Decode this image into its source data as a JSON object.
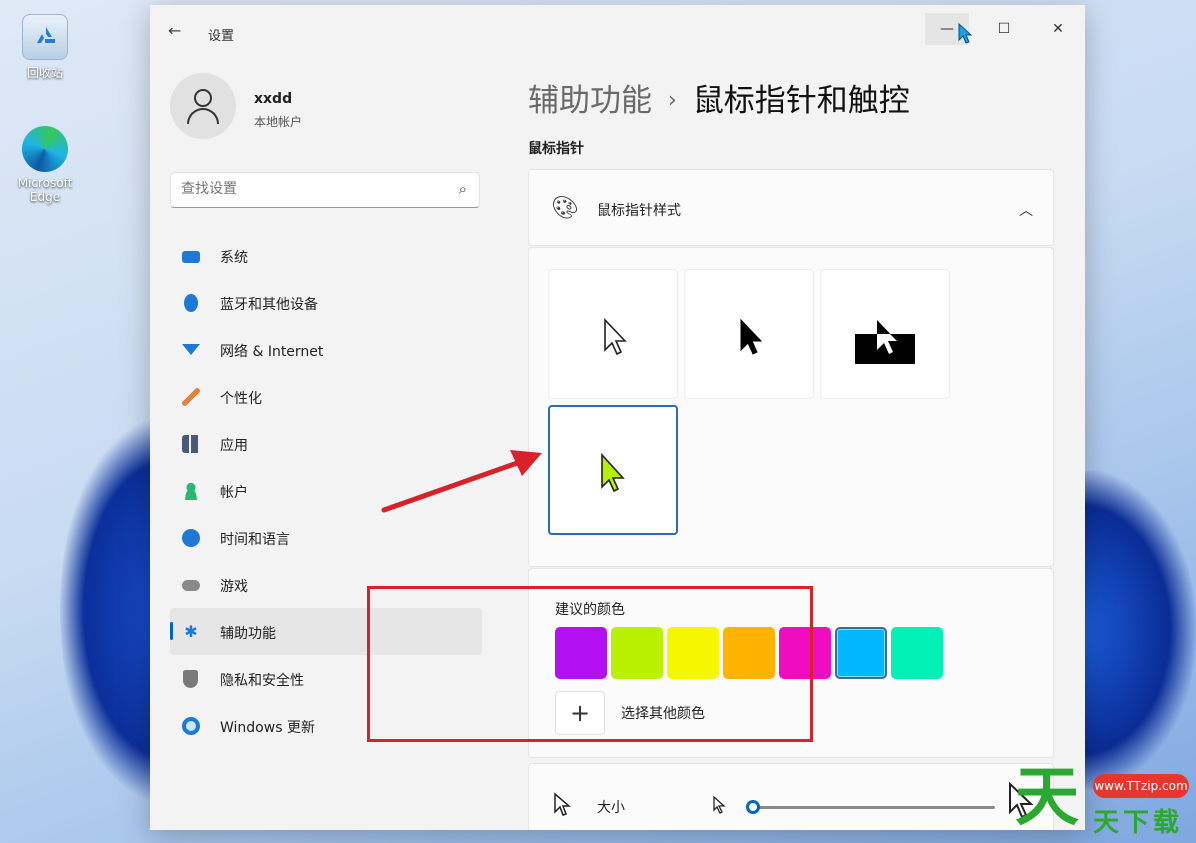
{
  "desktop": {
    "icons": [
      {
        "label": "回收站",
        "icon": "recycle-bin-icon"
      },
      {
        "label": "Microsoft Edge",
        "icon": "edge-icon"
      }
    ]
  },
  "window": {
    "app_title": "设置",
    "back_icon": "back-arrow-icon",
    "controls": {
      "minimize": "—",
      "maximize": "☐",
      "close": "✕"
    }
  },
  "profile": {
    "name": "xxdd",
    "account_type": "本地帐户"
  },
  "search": {
    "placeholder": "查找设置",
    "value": "查找设置"
  },
  "nav": {
    "items": [
      {
        "label": "系统",
        "icon": "system-icon",
        "color": "#1e78d6"
      },
      {
        "label": "蓝牙和其他设备",
        "icon": "bluetooth-icon",
        "color": "#1e78d6"
      },
      {
        "label": "网络 & Internet",
        "icon": "wifi-icon",
        "color": "#1e78d6"
      },
      {
        "label": "个性化",
        "icon": "brush-icon",
        "color": "#e0843a"
      },
      {
        "label": "应用",
        "icon": "apps-icon",
        "color": "#4a5a72"
      },
      {
        "label": "帐户",
        "icon": "account-icon",
        "color": "#2bb673"
      },
      {
        "label": "时间和语言",
        "icon": "globe-clock-icon",
        "color": "#1e78d6"
      },
      {
        "label": "游戏",
        "icon": "gamepad-icon",
        "color": "#7a7a7a"
      },
      {
        "label": "辅助功能",
        "icon": "accessibility-icon",
        "color": "#1e78d6"
      },
      {
        "label": "隐私和安全性",
        "icon": "shield-icon",
        "color": "#6b6b6b"
      },
      {
        "label": "Windows 更新",
        "icon": "update-icon",
        "color": "#1e78d6"
      }
    ],
    "active_index": 8
  },
  "breadcrumb": {
    "parent": "辅助功能",
    "separator": "›",
    "current": "鼠标指针和触控"
  },
  "section": {
    "title": "鼠标指针"
  },
  "pointer_style": {
    "label": "鼠标指针样式",
    "icon": "palette-icon",
    "expand_icon": "chevron-up-icon",
    "options": [
      {
        "name": "white",
        "icon": "cursor-white-icon"
      },
      {
        "name": "black",
        "icon": "cursor-black-icon"
      },
      {
        "name": "inverted",
        "icon": "cursor-inverted-icon"
      },
      {
        "name": "custom",
        "icon": "cursor-custom-icon",
        "color": "#b4f000",
        "selected": true
      }
    ]
  },
  "colors": {
    "label": "建议的颜色",
    "swatches": [
      "#b30ff0",
      "#b8f000",
      "#f6f600",
      "#ffb300",
      "#f00cc0",
      "#00b8ff",
      "#00f0b8"
    ],
    "selected_index": 5,
    "more_button": "+",
    "more_label": "选择其他颜色"
  },
  "size": {
    "label": "大小",
    "value": 0.02
  },
  "watermark": {
    "url": "www.TTzip.com",
    "big": "天",
    "text": "天下载"
  },
  "annotation": {
    "arrow_color": "#d8222a"
  }
}
